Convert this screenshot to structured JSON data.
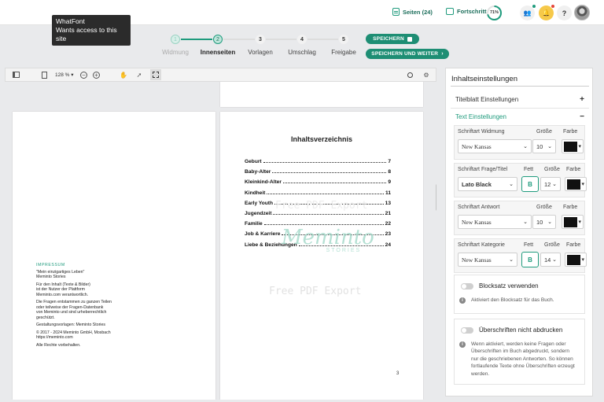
{
  "tooltip": {
    "title": "WhatFont",
    "subtitle": "Wants access to this site"
  },
  "topbar": {
    "pages_label": "Seiten (24)",
    "progress_label": "Fortschritt",
    "progress_percent": "71%",
    "progress_value": 0.71,
    "icons": [
      "user-add-icon",
      "bell-icon",
      "help-icon",
      "avatar"
    ],
    "help_glyph": "?",
    "accent": "#1f9b7d"
  },
  "steps": [
    {
      "num": "1",
      "label": "Widmung",
      "state": "done"
    },
    {
      "num": "2",
      "label": "Innenseiten",
      "state": "active"
    },
    {
      "num": "3",
      "label": "Vorlagen",
      "state": "todo"
    },
    {
      "num": "4",
      "label": "Umschlag",
      "state": "todo"
    },
    {
      "num": "5",
      "label": "Freigabe",
      "state": "todo"
    }
  ],
  "actions": {
    "save": "SPEICHERN",
    "save_continue": "SPEICHERN UND WEITER"
  },
  "viewer": {
    "zoom": "128 %",
    "tools": [
      "sidebar-toggle-icon",
      "document-icon",
      "zoom-out-icon",
      "zoom-in-icon",
      "hand-tool-icon",
      "select-tool-icon",
      "marquee-tool-icon",
      "search-icon",
      "settings-icon"
    ]
  },
  "toc": {
    "title": "Inhaltsverzeichnis",
    "entries": [
      {
        "label": "Geburt",
        "page": "7"
      },
      {
        "label": "Baby-Alter",
        "page": "8"
      },
      {
        "label": "Kleinkind-Alter",
        "page": "9"
      },
      {
        "label": "Kindheit",
        "page": "11"
      },
      {
        "label": "Early Youth",
        "page": "13"
      },
      {
        "label": "Jugendzeit",
        "page": "21"
      },
      {
        "label": "Familie",
        "page": "22"
      },
      {
        "label": "Job & Karriere",
        "page": "23"
      },
      {
        "label": "Liebe & Beziehungen",
        "page": "24"
      }
    ],
    "watermark_logo": "Meminto",
    "watermark_logo_sub": "STORIES",
    "watermark_text": "Free PDF Export",
    "page_number": "3"
  },
  "imprint": {
    "heading": "IMPRESSUM",
    "lines": [
      "\"Mein einzigartiges Leben\"",
      "Meminto Stories",
      "",
      "Für den Inhalt (Texte & Bilder)",
      "ist der Nutzer der Plattform",
      "Meminto.com verantwortlich.",
      "",
      "Die Fragen entstammen zu ganzen Teilen",
      "oder teilweise der Fragen-Datenbank",
      "von Meminto und sind urheberrechtlich",
      "geschützt.",
      "",
      "Gestaltungsvorlagen: Meminto Stories",
      "",
      "© 2017 - 2024 Meminto GmbH, Mosbach",
      "https://meminto.com",
      "",
      "Alle Rechte vorbehalten."
    ]
  },
  "panel": {
    "title": "Inhaltseinstellungen",
    "titlepage_label": "Titelblatt Einstellungen",
    "plus": "+",
    "minus": "−",
    "text_settings_label": "Text Einstellungen",
    "size_label": "Größe",
    "color_label": "Farbe",
    "bold_label": "Fett",
    "bold_glyph": "B",
    "caret": "▾",
    "groups": [
      {
        "label": "Schriftart Widmung",
        "font": "New Kansas",
        "size": "10",
        "color": "#111111",
        "has_bold": false,
        "bold_font": false
      },
      {
        "label": "Schriftart Frage/Titel",
        "font": "Lato Black",
        "size": "12",
        "color": "#111111",
        "has_bold": true,
        "bold_font": true
      },
      {
        "label": "Schriftart Antwort",
        "font": "New Kansas",
        "size": "10",
        "color": "#111111",
        "has_bold": false,
        "bold_font": false
      },
      {
        "label": "Schriftart Kategorie",
        "font": "New Kansas",
        "size": "14",
        "color": "#111111",
        "has_bold": true,
        "bold_font": false
      }
    ],
    "justify": {
      "label": "Blocksatz verwenden",
      "enabled": false,
      "info": "Aktiviert den Blocksatz für das Buch."
    },
    "headings": {
      "label": "Überschriften nicht abdrucken",
      "enabled": false,
      "info_lines": [
        "Wenn aktiviert, werden keine Fragen oder",
        "Überschriften im Buch abgedruckt, sondern",
        "nur die geschriebenen Antworten. So können",
        "fortlaufende Texte ohne Überschriften erzeugt",
        "werden."
      ]
    }
  }
}
